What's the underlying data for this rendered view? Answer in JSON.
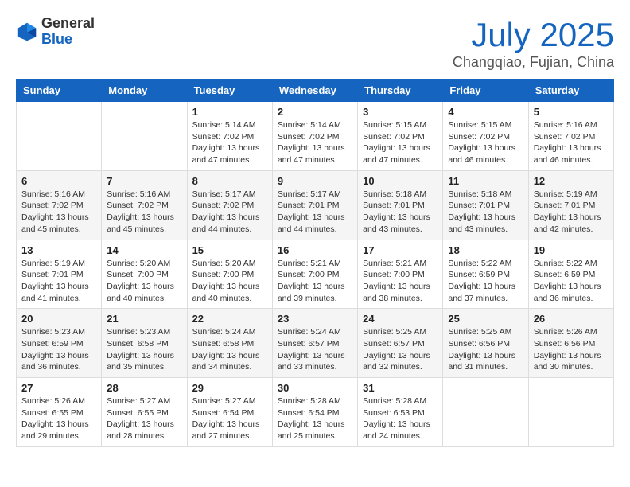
{
  "logo": {
    "general": "General",
    "blue": "Blue"
  },
  "header": {
    "title": "July 2025",
    "subtitle": "Changqiao, Fujian, China"
  },
  "weekdays": [
    "Sunday",
    "Monday",
    "Tuesday",
    "Wednesday",
    "Thursday",
    "Friday",
    "Saturday"
  ],
  "weeks": [
    [
      {
        "day": "",
        "info": ""
      },
      {
        "day": "",
        "info": ""
      },
      {
        "day": "1",
        "info": "Sunrise: 5:14 AM\nSunset: 7:02 PM\nDaylight: 13 hours and 47 minutes."
      },
      {
        "day": "2",
        "info": "Sunrise: 5:14 AM\nSunset: 7:02 PM\nDaylight: 13 hours and 47 minutes."
      },
      {
        "day": "3",
        "info": "Sunrise: 5:15 AM\nSunset: 7:02 PM\nDaylight: 13 hours and 47 minutes."
      },
      {
        "day": "4",
        "info": "Sunrise: 5:15 AM\nSunset: 7:02 PM\nDaylight: 13 hours and 46 minutes."
      },
      {
        "day": "5",
        "info": "Sunrise: 5:16 AM\nSunset: 7:02 PM\nDaylight: 13 hours and 46 minutes."
      }
    ],
    [
      {
        "day": "6",
        "info": "Sunrise: 5:16 AM\nSunset: 7:02 PM\nDaylight: 13 hours and 45 minutes."
      },
      {
        "day": "7",
        "info": "Sunrise: 5:16 AM\nSunset: 7:02 PM\nDaylight: 13 hours and 45 minutes."
      },
      {
        "day": "8",
        "info": "Sunrise: 5:17 AM\nSunset: 7:02 PM\nDaylight: 13 hours and 44 minutes."
      },
      {
        "day": "9",
        "info": "Sunrise: 5:17 AM\nSunset: 7:01 PM\nDaylight: 13 hours and 44 minutes."
      },
      {
        "day": "10",
        "info": "Sunrise: 5:18 AM\nSunset: 7:01 PM\nDaylight: 13 hours and 43 minutes."
      },
      {
        "day": "11",
        "info": "Sunrise: 5:18 AM\nSunset: 7:01 PM\nDaylight: 13 hours and 43 minutes."
      },
      {
        "day": "12",
        "info": "Sunrise: 5:19 AM\nSunset: 7:01 PM\nDaylight: 13 hours and 42 minutes."
      }
    ],
    [
      {
        "day": "13",
        "info": "Sunrise: 5:19 AM\nSunset: 7:01 PM\nDaylight: 13 hours and 41 minutes."
      },
      {
        "day": "14",
        "info": "Sunrise: 5:20 AM\nSunset: 7:00 PM\nDaylight: 13 hours and 40 minutes."
      },
      {
        "day": "15",
        "info": "Sunrise: 5:20 AM\nSunset: 7:00 PM\nDaylight: 13 hours and 40 minutes."
      },
      {
        "day": "16",
        "info": "Sunrise: 5:21 AM\nSunset: 7:00 PM\nDaylight: 13 hours and 39 minutes."
      },
      {
        "day": "17",
        "info": "Sunrise: 5:21 AM\nSunset: 7:00 PM\nDaylight: 13 hours and 38 minutes."
      },
      {
        "day": "18",
        "info": "Sunrise: 5:22 AM\nSunset: 6:59 PM\nDaylight: 13 hours and 37 minutes."
      },
      {
        "day": "19",
        "info": "Sunrise: 5:22 AM\nSunset: 6:59 PM\nDaylight: 13 hours and 36 minutes."
      }
    ],
    [
      {
        "day": "20",
        "info": "Sunrise: 5:23 AM\nSunset: 6:59 PM\nDaylight: 13 hours and 36 minutes."
      },
      {
        "day": "21",
        "info": "Sunrise: 5:23 AM\nSunset: 6:58 PM\nDaylight: 13 hours and 35 minutes."
      },
      {
        "day": "22",
        "info": "Sunrise: 5:24 AM\nSunset: 6:58 PM\nDaylight: 13 hours and 34 minutes."
      },
      {
        "day": "23",
        "info": "Sunrise: 5:24 AM\nSunset: 6:57 PM\nDaylight: 13 hours and 33 minutes."
      },
      {
        "day": "24",
        "info": "Sunrise: 5:25 AM\nSunset: 6:57 PM\nDaylight: 13 hours and 32 minutes."
      },
      {
        "day": "25",
        "info": "Sunrise: 5:25 AM\nSunset: 6:56 PM\nDaylight: 13 hours and 31 minutes."
      },
      {
        "day": "26",
        "info": "Sunrise: 5:26 AM\nSunset: 6:56 PM\nDaylight: 13 hours and 30 minutes."
      }
    ],
    [
      {
        "day": "27",
        "info": "Sunrise: 5:26 AM\nSunset: 6:55 PM\nDaylight: 13 hours and 29 minutes."
      },
      {
        "day": "28",
        "info": "Sunrise: 5:27 AM\nSunset: 6:55 PM\nDaylight: 13 hours and 28 minutes."
      },
      {
        "day": "29",
        "info": "Sunrise: 5:27 AM\nSunset: 6:54 PM\nDaylight: 13 hours and 27 minutes."
      },
      {
        "day": "30",
        "info": "Sunrise: 5:28 AM\nSunset: 6:54 PM\nDaylight: 13 hours and 25 minutes."
      },
      {
        "day": "31",
        "info": "Sunrise: 5:28 AM\nSunset: 6:53 PM\nDaylight: 13 hours and 24 minutes."
      },
      {
        "day": "",
        "info": ""
      },
      {
        "day": "",
        "info": ""
      }
    ]
  ]
}
